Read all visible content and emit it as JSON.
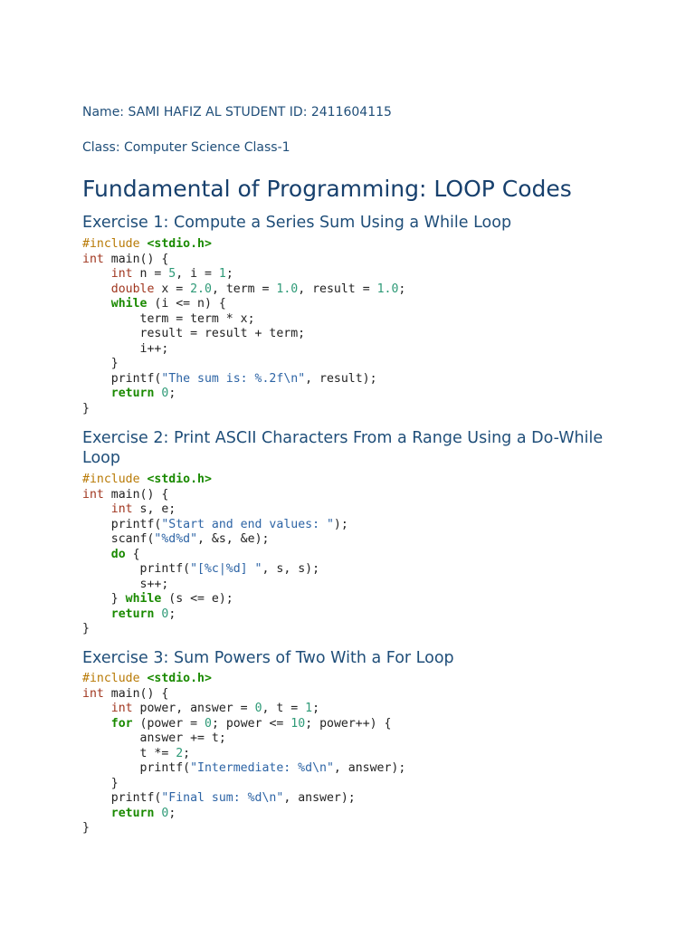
{
  "header": {
    "name_line": "Name: SAMI HAFIZ AL STUDENT ID: 2411604115",
    "class_line": "Class: Computer Science Class-1",
    "title": "Fundamental of Programming: LOOP Codes"
  },
  "exercises": [
    {
      "heading": "Exercise 1: Compute a Series Sum Using a While Loop",
      "code": [
        [
          [
            "pp",
            "#include "
          ],
          [
            "inc",
            "<stdio.h>"
          ]
        ],
        [
          [
            "ty",
            "int"
          ],
          [
            "",
            "main() {"
          ]
        ],
        [
          [
            "",
            "    "
          ],
          [
            "ty",
            "int"
          ],
          [
            "",
            "n = "
          ],
          [
            "num",
            "5"
          ],
          [
            "",
            ", i = "
          ],
          [
            "num",
            "1"
          ],
          [
            "",
            ";"
          ]
        ],
        [
          [
            "",
            "    "
          ],
          [
            "ty",
            "double"
          ],
          [
            "",
            "x = "
          ],
          [
            "num",
            "2.0"
          ],
          [
            "",
            ", term = "
          ],
          [
            "num",
            "1.0"
          ],
          [
            "",
            ", result = "
          ],
          [
            "num",
            "1.0"
          ],
          [
            "",
            ";"
          ]
        ],
        [
          [
            "",
            "    "
          ],
          [
            "kw",
            "while"
          ],
          [
            "",
            " (i <= n) {"
          ]
        ],
        [
          [
            "",
            "        term = term * x;"
          ]
        ],
        [
          [
            "",
            "        result = result + term;"
          ]
        ],
        [
          [
            "",
            "        i++;"
          ]
        ],
        [
          [
            "",
            "    }"
          ]
        ],
        [
          [
            "",
            "    printf("
          ],
          [
            "str",
            "\"The sum is: %.2f\\n\""
          ],
          [
            "",
            ", result);"
          ]
        ],
        [
          [
            "",
            "    "
          ],
          [
            "kw",
            "return"
          ],
          [
            "",
            " "
          ],
          [
            "num",
            "0"
          ],
          [
            "",
            ";"
          ]
        ],
        [
          [
            "",
            "}"
          ]
        ]
      ]
    },
    {
      "heading": "Exercise 2: Print ASCII Characters From a Range Using a Do-While Loop",
      "code": [
        [
          [
            "pp",
            "#include "
          ],
          [
            "inc",
            "<stdio.h>"
          ]
        ],
        [
          [
            "ty",
            "int"
          ],
          [
            "",
            "main() {"
          ]
        ],
        [
          [
            "",
            "    "
          ],
          [
            "ty",
            "int"
          ],
          [
            "",
            "s, e;"
          ]
        ],
        [
          [
            "",
            "    printf("
          ],
          [
            "str",
            "\"Start and end values: \""
          ],
          [
            "",
            ");"
          ]
        ],
        [
          [
            "",
            "    scanf("
          ],
          [
            "str",
            "\"%d%d\""
          ],
          [
            "",
            ", &s, &e);"
          ]
        ],
        [
          [
            "",
            "    "
          ],
          [
            "kw",
            "do"
          ],
          [
            "",
            " {"
          ]
        ],
        [
          [
            "",
            "        printf("
          ],
          [
            "str",
            "\"[%c|%d] \""
          ],
          [
            "",
            ", s, s);"
          ]
        ],
        [
          [
            "",
            "        s++;"
          ]
        ],
        [
          [
            "",
            "    } "
          ],
          [
            "kw",
            "while"
          ],
          [
            "",
            " (s <= e);"
          ]
        ],
        [
          [
            "",
            "    "
          ],
          [
            "kw",
            "return"
          ],
          [
            "",
            " "
          ],
          [
            "num",
            "0"
          ],
          [
            "",
            ";"
          ]
        ],
        [
          [
            "",
            "}"
          ]
        ]
      ]
    },
    {
      "heading": "Exercise 3: Sum Powers of Two With a For Loop",
      "code": [
        [
          [
            "pp",
            "#include "
          ],
          [
            "inc",
            "<stdio.h>"
          ]
        ],
        [
          [
            "ty",
            "int"
          ],
          [
            "",
            "main() {"
          ]
        ],
        [
          [
            "",
            "    "
          ],
          [
            "ty",
            "int"
          ],
          [
            "",
            "power, answer = "
          ],
          [
            "num",
            "0"
          ],
          [
            "",
            ", t = "
          ],
          [
            "num",
            "1"
          ],
          [
            "",
            ";"
          ]
        ],
        [
          [
            "",
            "    "
          ],
          [
            "kw",
            "for"
          ],
          [
            "",
            " (power = "
          ],
          [
            "num",
            "0"
          ],
          [
            "",
            "; power <= "
          ],
          [
            "num",
            "10"
          ],
          [
            "",
            "; power++) {"
          ]
        ],
        [
          [
            "",
            "        answer += t;"
          ]
        ],
        [
          [
            "",
            "        t *= "
          ],
          [
            "num",
            "2"
          ],
          [
            "",
            ";"
          ]
        ],
        [
          [
            "",
            "        printf("
          ],
          [
            "str",
            "\"Intermediate: %d\\n\""
          ],
          [
            "",
            ", answer);"
          ]
        ],
        [
          [
            "",
            "    }"
          ]
        ],
        [
          [
            "",
            "    printf("
          ],
          [
            "str",
            "\"Final sum: %d\\n\""
          ],
          [
            "",
            ", answer);"
          ]
        ],
        [
          [
            "",
            "    "
          ],
          [
            "kw",
            "return"
          ],
          [
            "",
            " "
          ],
          [
            "num",
            "0"
          ],
          [
            "",
            ";"
          ]
        ],
        [
          [
            "",
            "}"
          ]
        ]
      ]
    }
  ]
}
